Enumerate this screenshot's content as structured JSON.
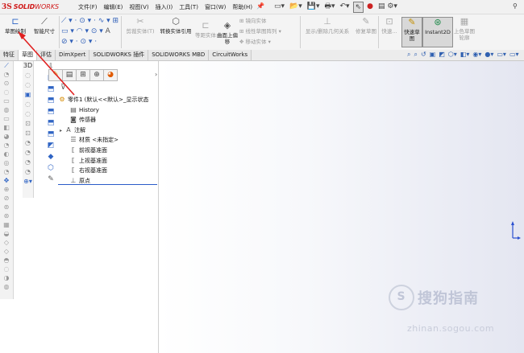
{
  "app": {
    "logo_ds": "3S",
    "logo_solid": "SOLID",
    "logo_works": "WORKS"
  },
  "menu": [
    "文件(F)",
    "编辑(E)",
    "视图(V)",
    "插入(I)",
    "工具(T)",
    "窗口(W)",
    "帮助(H)"
  ],
  "quick_icons": [
    "new-icon",
    "open-icon",
    "save-icon",
    "print-icon",
    "undo-icon",
    "select-icon",
    "traffic-light-icon",
    "options-icon"
  ],
  "ribbon": {
    "sketch": "草图绘制",
    "smart_dim": "智能尺寸",
    "trim": "剪裁实体(T)",
    "convert": "转换实体引用",
    "offset": "等距实体",
    "surface_offset": "曲面上偏移",
    "mirror": "镜向实体",
    "linear_pattern": "线性草图阵列",
    "move": "移动实体",
    "relations": "显示/删除几何关系",
    "repair": "修复草图",
    "quick_snap": "快速...",
    "rapid_sketch": "快速草图",
    "instant2d": "Instant2D",
    "shaded_sketch": "上色草图轮廓"
  },
  "tabs": [
    {
      "label": "特征",
      "active": false
    },
    {
      "label": "草图",
      "active": true
    },
    {
      "label": "评估",
      "active": false
    },
    {
      "label": "DimXpert",
      "active": false
    },
    {
      "label": "SOLIDWORKS 插件",
      "active": false
    },
    {
      "label": "SOLIDWORKS MBD",
      "active": false
    },
    {
      "label": "CircuitWorks",
      "active": false
    }
  ],
  "tree": {
    "root": "零件1 (默认<<默认>_显示状态",
    "items": [
      {
        "label": "History",
        "icon": "history-icon",
        "expand": false
      },
      {
        "label": "传感器",
        "icon": "sensor-icon",
        "expand": false
      },
      {
        "label": "注解",
        "icon": "annotation-icon",
        "expand": true
      },
      {
        "label": "材质 <未指定>",
        "icon": "material-icon",
        "expand": false
      },
      {
        "label": "前视基准面",
        "icon": "plane-icon",
        "expand": false
      },
      {
        "label": "上视基准面",
        "icon": "plane-icon",
        "expand": false
      },
      {
        "label": "右视基准面",
        "icon": "plane-icon",
        "expand": false
      },
      {
        "label": "原点",
        "icon": "origin-icon",
        "expand": false
      }
    ]
  },
  "watermark": {
    "title": "搜狗指南",
    "sub": "zhinan.sogou.com"
  },
  "colors": {
    "accent": "#2a62c5",
    "annotation": "#e02020",
    "logo": "#d01a1a"
  }
}
